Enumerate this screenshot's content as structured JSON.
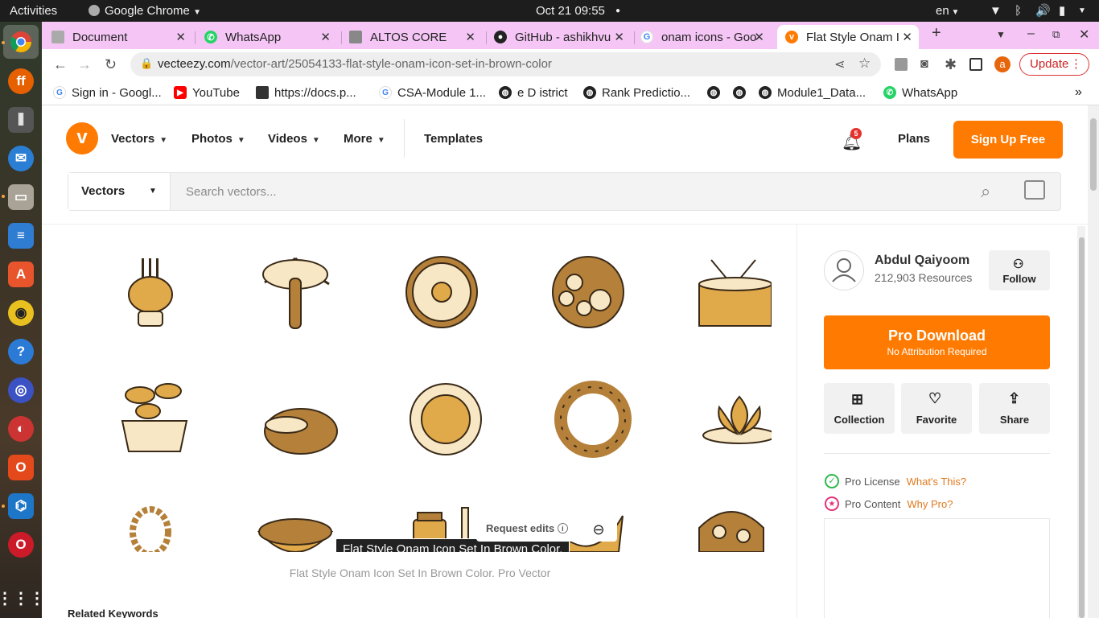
{
  "system": {
    "activities": "Activities",
    "app": "Google Chrome",
    "datetime": "Oct 21  09:55",
    "lang": "en"
  },
  "tabs": [
    {
      "label": "Document",
      "icon": "document-icon"
    },
    {
      "label": "WhatsApp",
      "icon": "whatsapp-icon"
    },
    {
      "label": "ALTOS CORE",
      "icon": "altos-icon"
    },
    {
      "label": "GitHub - ashikhvu",
      "icon": "github-icon"
    },
    {
      "label": "onam icons - Goo",
      "icon": "google-icon"
    },
    {
      "label": "Flat Style Onam I",
      "icon": "vecteezy-icon"
    }
  ],
  "address": {
    "domain": "vecteezy.com",
    "path": "/vector-art/25054133-flat-style-onam-icon-set-in-brown-color"
  },
  "profile_letter": "a",
  "update_label": "Update",
  "bookmarks": [
    {
      "label": "Sign in - Googl..."
    },
    {
      "label": "YouTube"
    },
    {
      "label": "https://docs.p..."
    },
    {
      "label": "CSA-Module 1..."
    },
    {
      "label": "e D istrict"
    },
    {
      "label": "Rank Predictio..."
    },
    {
      "label": ""
    },
    {
      "label": ""
    },
    {
      "label": "Module1_Data..."
    },
    {
      "label": "WhatsApp"
    }
  ],
  "site": {
    "nav": [
      "Vectors",
      "Photos",
      "Videos",
      "More"
    ],
    "templates": "Templates",
    "notif_count": "5",
    "plans": "Plans",
    "signup": "Sign Up Free",
    "search_category": "Vectors",
    "search_placeholder": "Search vectors..."
  },
  "preview": {
    "tooltip": "Flat Style Onam Icon Set In Brown Color.",
    "request_edits": "Request edits",
    "caption": "Flat Style Onam Icon Set In Brown Color. Pro Vector",
    "colors": {
      "brown": "#b5813a",
      "gold": "#e0a94a",
      "cream": "#f8e7c4",
      "outline": "#3a2a18"
    }
  },
  "related_keywords": "Related Keywords",
  "sidebar": {
    "author_name": "Abdul Qaiyoom",
    "author_resources": "212,903 Resources",
    "follow": "Follow",
    "pro_download": "Pro Download",
    "pro_sub": "No Attribution Required",
    "actions": [
      "Collection",
      "Favorite",
      "Share"
    ],
    "pro_license": "Pro License",
    "whats_this": "What's This?",
    "pro_content": "Pro Content",
    "why_pro": "Why Pro?"
  },
  "brand_color": "#ff7a00",
  "tab_strip_color": "#f5c6f5"
}
